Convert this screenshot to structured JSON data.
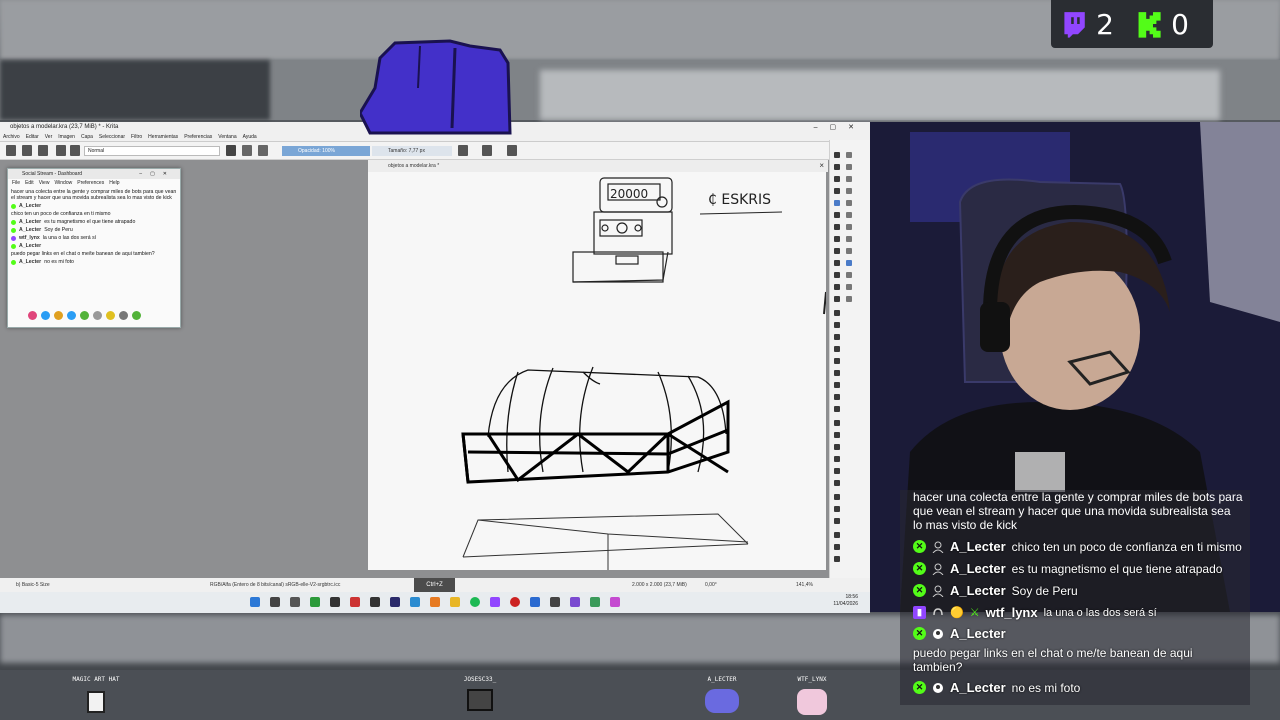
{
  "score": {
    "twitch_count": "2",
    "kick_count": "0",
    "twitch_color": "#9146ff",
    "kick_color": "#53fc18"
  },
  "krita": {
    "title": "objetos a modelar.kra (23,7 MiB) * - Krita",
    "menu": [
      "Archivo",
      "Editar",
      "Ver",
      "Imagen",
      "Capa",
      "Seleccionar",
      "Filtro",
      "Herramientas",
      "Preferencias",
      "Ventana",
      "Ayuda"
    ],
    "blend_mode": "Normal",
    "opacity": "Opacidad: 100%",
    "size": "Tamaño: 7,77 px",
    "doc_tab": "objetos a modelar.kra *",
    "status_brush": "b) Basic-5 Size",
    "status_color": "RGB/Alfa (Entero de 8 bits/canal)  sRGB-elle-V2-srgbtrc.icc",
    "status_ctrlz": "Ctrl+Z",
    "status_dims": "2.000 x 2.000 (23,7 MiB)",
    "status_angle": "0,00°",
    "status_zoom": "141,4%",
    "clock_time": "18:56",
    "clock_date": "11/04/2026",
    "canvas_note": "₵ ESKRIS",
    "slot_value": "20000"
  },
  "social_stream": {
    "title": "Social Stream - Dashboard",
    "menu": [
      "File",
      "Edit",
      "View",
      "Window",
      "Preferences",
      "Help"
    ],
    "lines": [
      {
        "type": "text",
        "text": "hacer una colecta entre la gente y comprar miles de bots para que vean el stream y hacer que una movida subrealista sea lo mas visto de kick"
      },
      {
        "type": "user",
        "platform": "kick",
        "user": "A_Lecter",
        "text": ""
      },
      {
        "type": "text",
        "text": "chico ten un poco de confianza en ti mismo"
      },
      {
        "type": "user",
        "platform": "kick",
        "user": "A_Lecter",
        "text": "es tu magnetismo el que tiene atrapado"
      },
      {
        "type": "user",
        "platform": "kick",
        "user": "A_Lecter",
        "text": "Soy de Peru"
      },
      {
        "type": "user",
        "platform": "twitch",
        "user": "wtf_lynx",
        "text": "la una o las dos será sí"
      },
      {
        "type": "user",
        "platform": "kick",
        "user": "A_Lecter",
        "text": ""
      },
      {
        "type": "text",
        "text": "puedo pegar links en el chat o me/te banean de aqui tambien?"
      },
      {
        "type": "user",
        "platform": "kick",
        "user": "A_Lecter",
        "text": "no es mi foto"
      }
    ]
  },
  "chat": {
    "top_text": "hacer una colecta entre la gente y comprar miles de bots para que vean el stream y hacer que una movida subrealista sea lo mas visto de kick",
    "messages": [
      {
        "platform": "kick",
        "user": "A_Lecter",
        "text": "chico ten un poco de confianza en ti mismo"
      },
      {
        "platform": "kick",
        "user": "A_Lecter",
        "text": "es tu magnetismo el que tiene atrapado"
      },
      {
        "platform": "kick",
        "user": "A_Lecter",
        "text": "Soy de Peru"
      },
      {
        "platform": "twitch",
        "user": "wtf_lynx",
        "text": "la una o las dos será sí"
      },
      {
        "platform": "kick",
        "user": "A_Lecter",
        "text": ""
      },
      {
        "platform": "kick",
        "user": "A_Lecter",
        "text": "no es mi foto"
      }
    ],
    "long_message": "puedo pegar links en el chat o me/te banean de aqui tambien?"
  },
  "avatars": [
    "MAGIC ART HAT",
    "JOSESC33_",
    "A_LECTER",
    "WTF_LYNX"
  ]
}
